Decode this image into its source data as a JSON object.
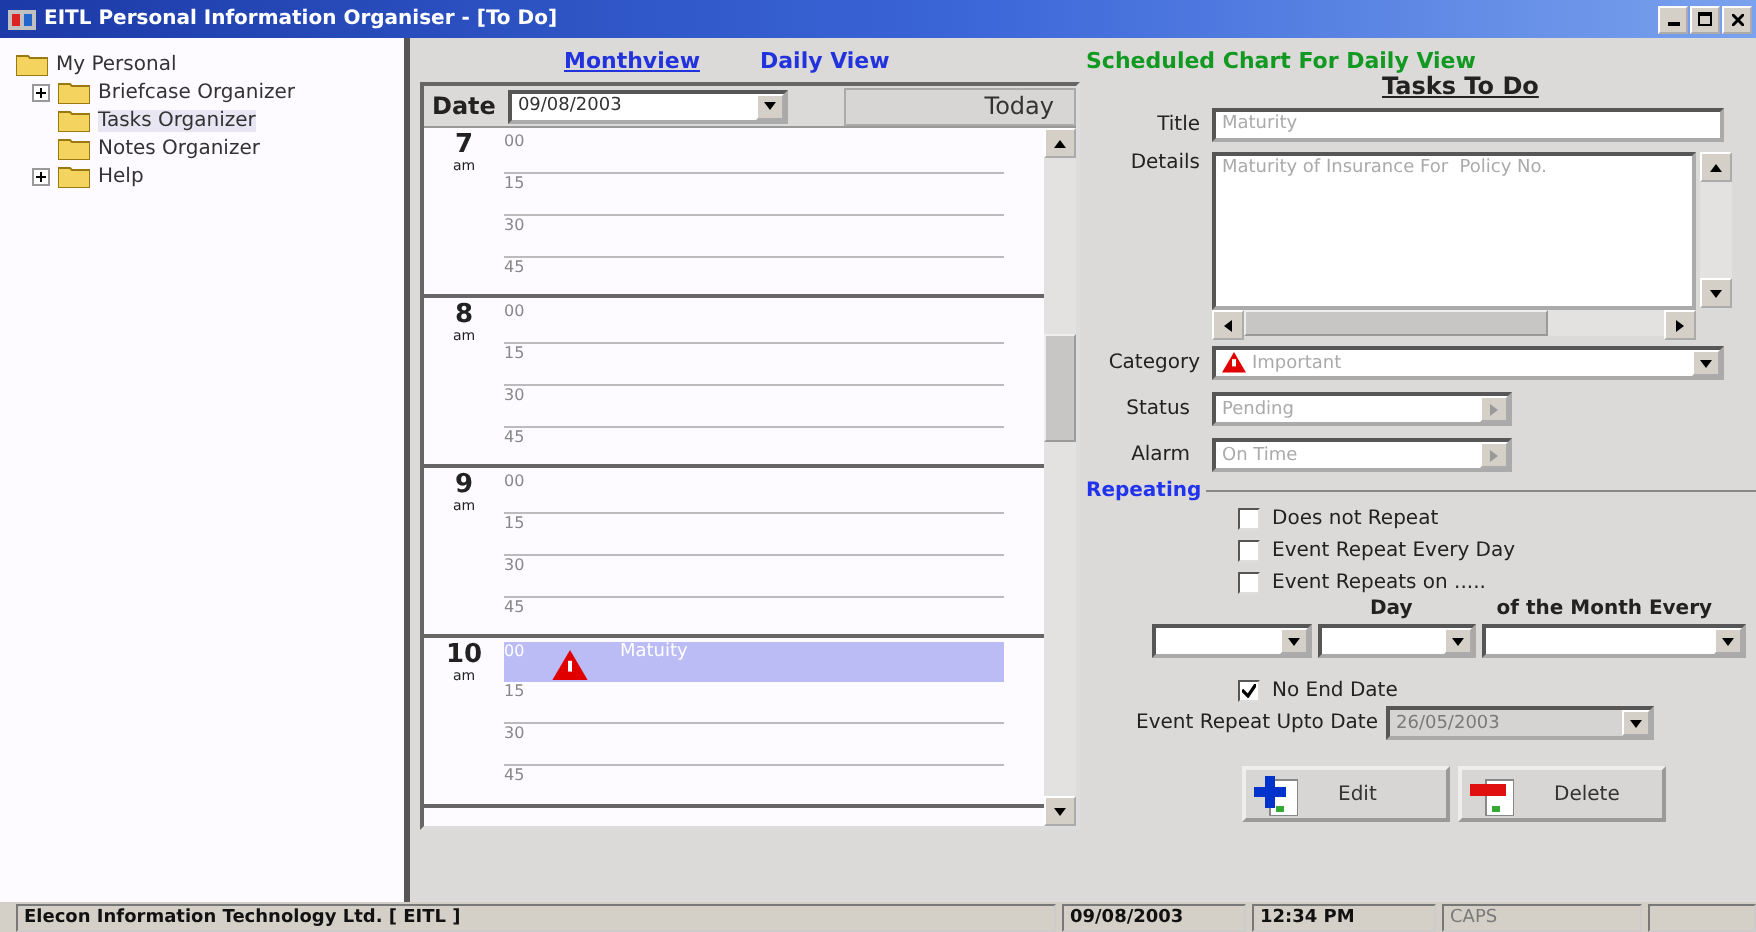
{
  "window": {
    "title": "EITL Personal Information Organiser - [To Do]"
  },
  "tree": {
    "label": "My Personal",
    "children": [
      {
        "label": "Briefcase Organizer",
        "expanded": false
      },
      {
        "label": "Tasks Organizer",
        "selected": true
      },
      {
        "label": "Notes Organizer",
        "selected": false
      },
      {
        "label": "Help",
        "expanded": false
      }
    ]
  },
  "nav_links": [
    "Monthview",
    "Daily View"
  ],
  "chart_heading": "Scheduled Chart For Daily View",
  "calendar": {
    "date_label": "Date",
    "date_value": "09/08/2003",
    "today_button": "Today",
    "hours": [
      {
        "hour": "7",
        "period": "am",
        "slots": [
          {
            "minute": "00"
          },
          {
            "minute": "15"
          },
          {
            "minute": "30"
          },
          {
            "minute": "45"
          }
        ]
      },
      {
        "hour": "8",
        "period": "am",
        "slots": [
          {
            "minute": "00"
          },
          {
            "minute": "15"
          },
          {
            "minute": "30"
          },
          {
            "minute": "45"
          }
        ]
      },
      {
        "hour": "9",
        "period": "am",
        "slots": [
          {
            "minute": "00"
          },
          {
            "minute": "15"
          },
          {
            "minute": "30"
          },
          {
            "minute": "45"
          }
        ]
      },
      {
        "hour": "10",
        "period": "am",
        "slots": [
          {
            "minute": "00",
            "event": "Matuity"
          },
          {
            "minute": "15"
          },
          {
            "minute": "30"
          },
          {
            "minute": "45"
          }
        ]
      }
    ]
  },
  "form": {
    "heading": "Tasks To Do",
    "title": {
      "label": "Title",
      "value": "Maturity"
    },
    "details": {
      "label": "Details",
      "value": "Maturity of Insurance For  Policy No."
    },
    "category": {
      "label": "Category",
      "value": "Important"
    },
    "status": {
      "label": "Status",
      "value": "Pending"
    },
    "alarm": {
      "label": "Alarm",
      "value": "On Time"
    },
    "repeating": {
      "label": "Repeating",
      "options": [
        {
          "label": "Does not Repeat",
          "checked": false
        },
        {
          "label": "Event Repeat Every Day",
          "checked": false
        },
        {
          "label": "Event Repeats on  .....",
          "checked": false
        }
      ],
      "column_headers": [
        "Day",
        "of the Month Every"
      ],
      "no_end_date": {
        "label": "No End Date",
        "checked": true
      },
      "upto_date": {
        "label": "Event Repeat Upto Date",
        "value": "26/05/2003",
        "disabled": true
      }
    },
    "buttons": [
      {
        "label": "Edit",
        "kind": "edit"
      },
      {
        "label": "Delete",
        "kind": "delete"
      }
    ]
  },
  "status_bar": [
    {
      "text": "Elecon Information Technology Ltd. [ EITL ]",
      "disabled": false
    },
    {
      "text": "09/08/2003",
      "disabled": false
    },
    {
      "text": "12:34 PM",
      "disabled": false
    },
    {
      "text": "CAPS",
      "disabled": true
    }
  ]
}
